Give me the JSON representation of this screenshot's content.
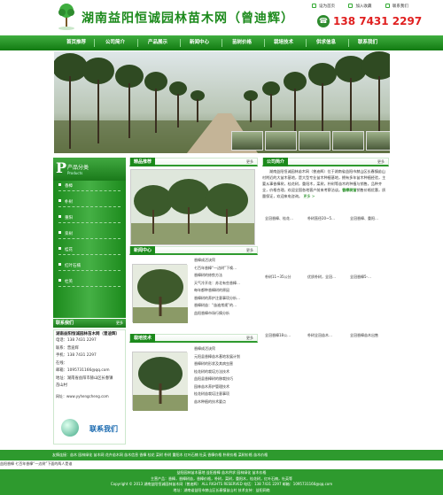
{
  "header": {
    "title": "湖南益阳恒诚园林苗木网（曾迪辉）",
    "top_links": [
      "设为首页",
      "加入收藏",
      "联系我们"
    ],
    "phone": "138 7431 2297"
  },
  "nav": {
    "items": [
      "首页推荐",
      "公司简介",
      "产品展示",
      "新闻中心",
      "苗树价格",
      "栽培技术",
      "供求信息",
      "联系我们"
    ]
  },
  "categories": {
    "title": "产品分类",
    "subtitle": "Products",
    "items": [
      "香樟",
      "朴树",
      "重阳",
      "栾树",
      "桂花",
      "红叶石楠",
      "杜英"
    ]
  },
  "contact": {
    "head": "联系我们",
    "more": "更多",
    "company": "湖南益阳恒诚园林苗木网（曾迪辉）",
    "lines": [
      "电话：138 7431 2297",
      "联系：曾迪辉",
      "手机：138 7431 2297",
      "在线：",
      "邮箱：1095731166@qq.com",
      "地址：湖南省益阳市赫山区长春镇",
      "苗山村"
    ],
    "url": "网址：www.yyhengcheng.com",
    "contact_us": "联系我们"
  },
  "featured": {
    "title": "精品推荐",
    "more": "更多",
    "caption": "香樟苗"
  },
  "news": {
    "title": "新闻中心",
    "more": "更多",
    "items": [
      "香樟成活诀窍",
      "七百年香樟“一边树”下唤…",
      "香樟树的修剪方法",
      "天气冷开花：苏北有些香樟…",
      "每年都种香樟树的原因",
      "香樟树的养护注意事项分析…",
      "香樟树苗：“苗逾常规”的…",
      "益阳香樟市场行情分析"
    ]
  },
  "tech": {
    "title": "栽培技术",
    "more": "更多",
    "items": [
      "香樟成活诀窍",
      "元阳县香樟苗木基地发展计划",
      "香樟树的形状及其病虫害",
      "桂花树的栽培方法技术",
      "益阳县香樟树的移栽技巧",
      "园林苗木养护管理技术",
      "桂花树苗栽培注意事项",
      "苗木种植的技术要点"
    ]
  },
  "about": {
    "title": "公司简介",
    "more": "更多",
    "text_prefix": "湖南益阳恒诚园林苗木网（曾迪辉）位于湖南省益阳市赫山区长春镇苗山村附近的大苗木基地，是大型专业苗木种植基地，拥有多年苗木种植经验，主要从事香樟树，桂花树，重阳木，栾树，朴树等苗木的种植与销售，品种齐全，价格合理，欢迎全国各地客户前来考察洽谈。",
    "highlight": "香樟树苗",
    "text_suffix": "销售价格优惠，质量保证，欢迎来电咨询。",
    "read_more": "更多 >"
  },
  "products": [
    "全冠香樟、桂花…",
    "朴树直径20~5…",
    "全冠香樟、重阳…",
    "朴树11~35公分",
    "优质朴树，全冠…",
    "全冠香樟5-…",
    "全冠香樟18公…",
    "朴树全冠苗木…",
    "全冠香樟苗木出售"
  ],
  "footer": {
    "links": "友情连接：苗木  园林绿化  苗木网  花卉苗木网  苗木信息  香樟  桂花  栾树  朴树  重阳木  红叶石楠  杜英  香樟价格  朴树价格  栾树价格  苗木价格",
    "links2": "益阳香樟  七百年香樟“一边树”下面的两人是谁",
    "row3": "益阳园林苗木基地  益阳香樟  苗木供求  园林绿化  苗木价格",
    "bar_lines": [
      "主营产品：香樟，香樟树苗，香樟价格，朴树，栾树，重阳木，桂花树，红叶石楠，杜英等",
      "Copyright © 2013  湖南益阳恒诚园林苗木网（曾迪辉） ALL RIGHTS RESERVED  电话：138 7431 2297  邮箱：1095731166@qq.com",
      "地址：湖南省益阳市赫山区长春镇苗山村  技术支持：益阳网络"
    ]
  },
  "colors": {
    "primary": "#1c8a1c",
    "phone": "#e02020"
  }
}
